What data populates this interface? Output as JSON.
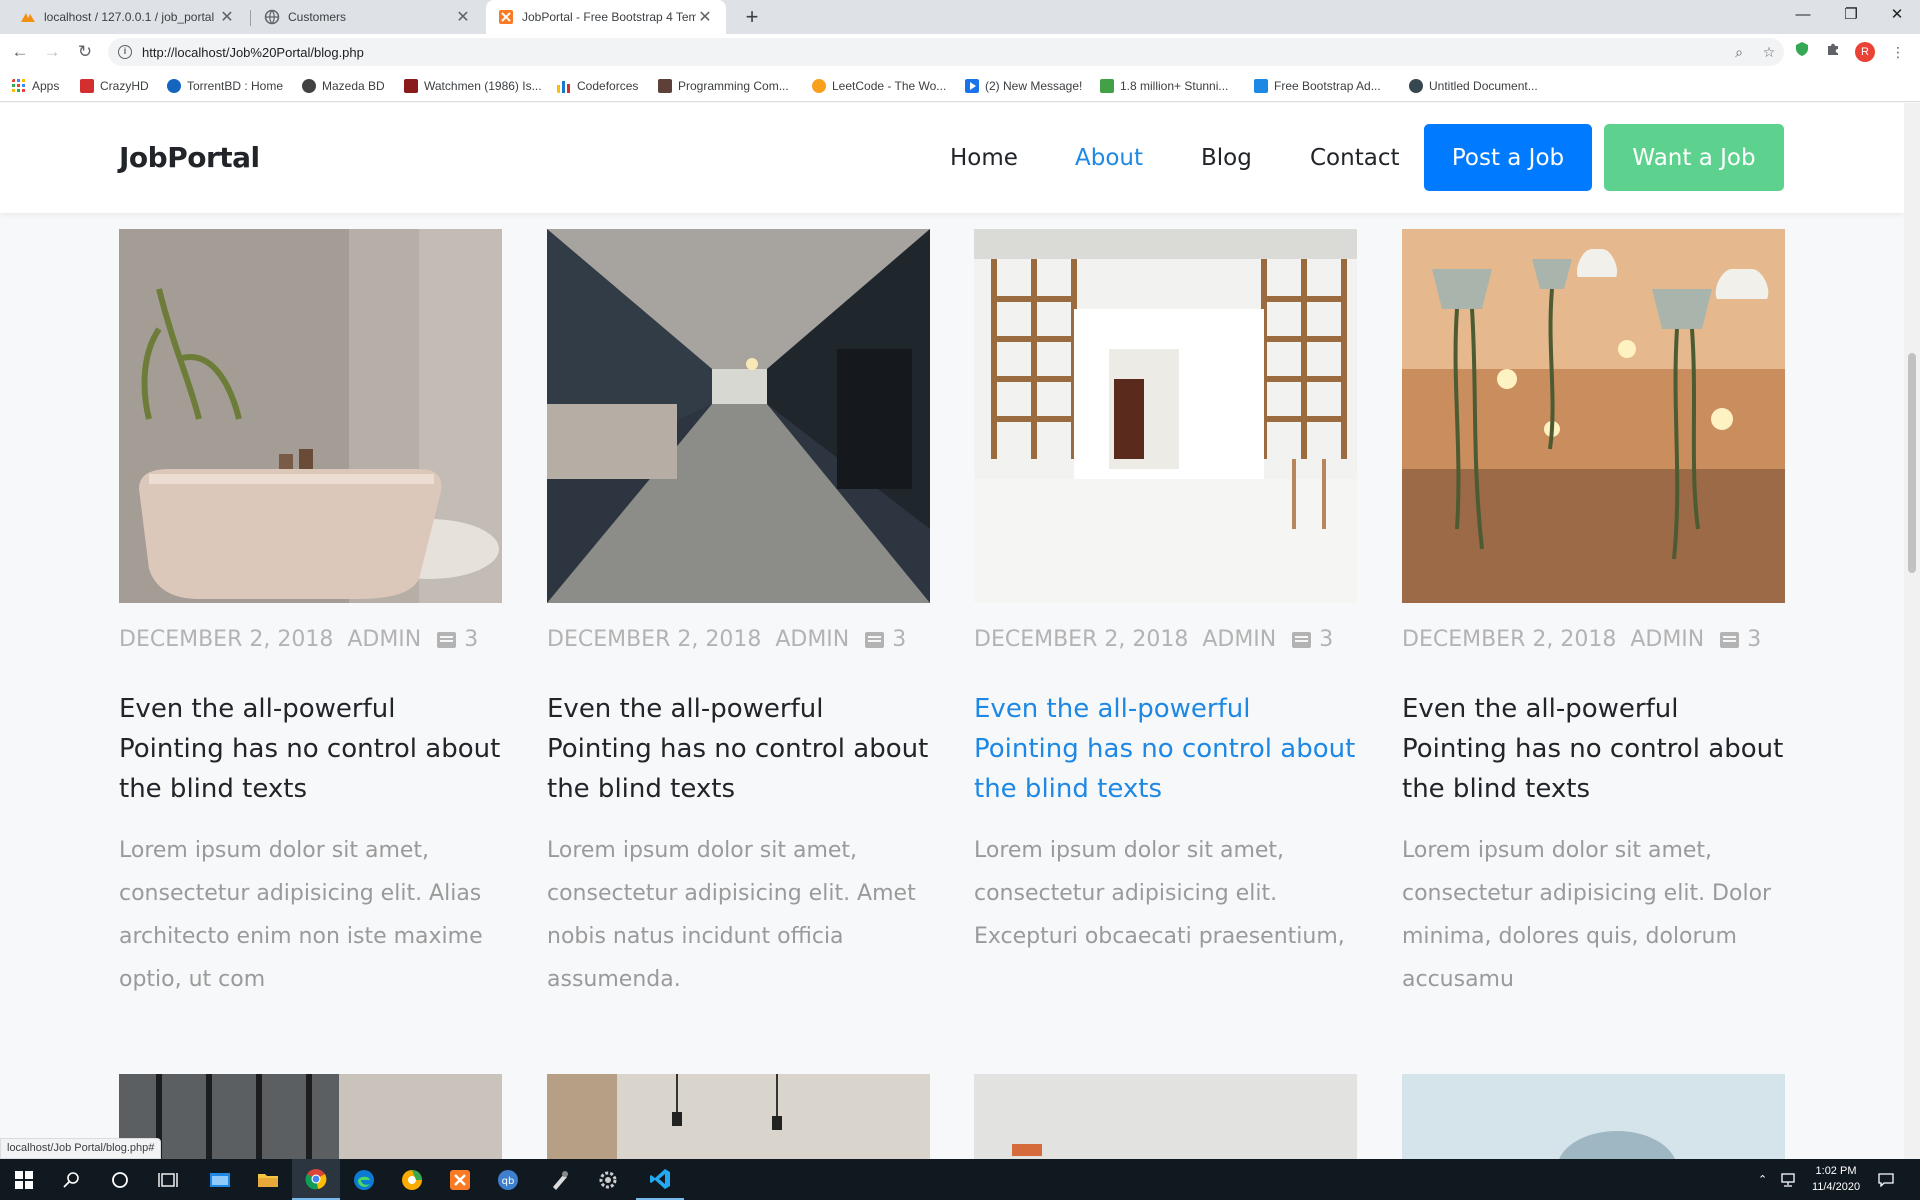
{
  "browser": {
    "tabs": [
      {
        "title": "localhost / 127.0.0.1 / job_portal",
        "active": false
      },
      {
        "title": "Customers",
        "active": false
      },
      {
        "title": "JobPortal - Free Bootstrap 4 Tem",
        "active": true
      }
    ],
    "new_tab_symbol": "+",
    "address": "http://localhost/Job%20Portal/blog.php",
    "profile_initial": "R",
    "status_url": "localhost/Job Portal/blog.php#",
    "bookmarks": [
      "Apps",
      "CrazyHD",
      "TorrentBD : Home",
      "Mazeda BD",
      "Watchmen (1986) Is...",
      "Codeforces",
      "Programming Com...",
      "LeetCode - The Wo...",
      "(2) New Message!",
      "1.8 million+ Stunni...",
      "Free Bootstrap Ad...",
      "Untitled Document..."
    ]
  },
  "site": {
    "brand": "JobPortal",
    "nav": [
      "Home",
      "About",
      "Blog",
      "Contact"
    ],
    "active_nav": "About",
    "post_job_label": "Post a Job",
    "want_job_label": "Want a Job",
    "accent_color": "#1e88e5",
    "post_button_color": "#007bff",
    "want_button_color": "#5dd28e"
  },
  "posts": [
    {
      "date": "DECEMBER 2, 2018",
      "author": "ADMIN",
      "comments": "3",
      "title": "Even the all-powerful Pointing has no control about the blind texts",
      "excerpt": "Lorem ipsum dolor sit amet, consectetur adipisicing elit. Alias architecto enim non iste maxime optio, ut com",
      "highlighted": false
    },
    {
      "date": "DECEMBER 2, 2018",
      "author": "ADMIN",
      "comments": "3",
      "title": "Even the all-powerful Pointing has no control about the blind texts",
      "excerpt": "Lorem ipsum dolor sit amet, consectetur adipisicing elit. Amet nobis natus incidunt officia assumenda.",
      "highlighted": false
    },
    {
      "date": "DECEMBER 2, 2018",
      "author": "ADMIN",
      "comments": "3",
      "title": "Even the all-powerful Pointing has no control about the blind texts",
      "excerpt": "Lorem ipsum dolor sit amet, consectetur adipisicing elit. Excepturi obcaecati praesentium,",
      "highlighted": true
    },
    {
      "date": "DECEMBER 2, 2018",
      "author": "ADMIN",
      "comments": "3",
      "title": "Even the all-powerful Pointing has no control about the blind texts",
      "excerpt": "Lorem ipsum dolor sit amet, consectetur adipisicing elit. Dolor minima, dolores quis, dolorum accusamu",
      "highlighted": false
    }
  ],
  "taskbar": {
    "time": "1:02 PM",
    "date": "11/4/2020"
  }
}
